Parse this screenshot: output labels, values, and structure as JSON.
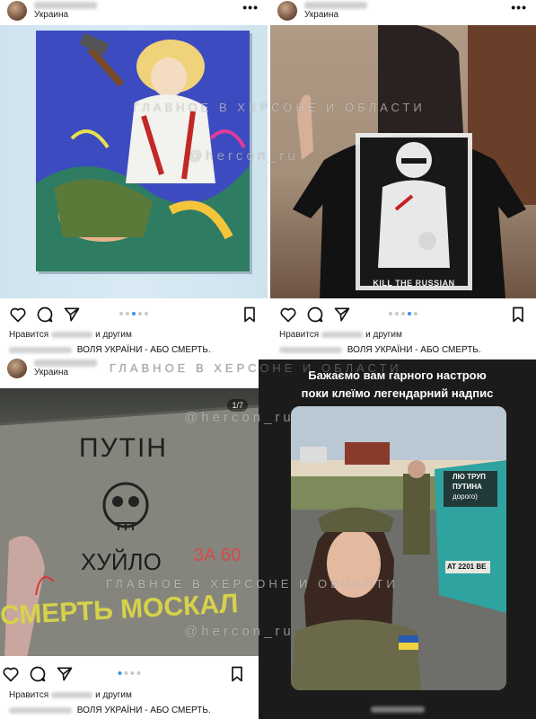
{
  "posts": [
    {
      "location": "Украина",
      "more": "•••",
      "likes_prefix": "Нравится",
      "likes_suffix": "и другим",
      "caption": "ВОЛЯ УКРАЇНИ - АБО СМЕРТЬ.",
      "carousel": {
        "count": 5,
        "active": 2
      }
    },
    {
      "location": "Украина",
      "more": "•••",
      "likes_prefix": "Нравится",
      "likes_suffix": "и другим",
      "caption": "ВОЛЯ УКРАЇНИ - АБО СМЕРТЬ.",
      "photo_text": "KILL THE RUSSIAN",
      "carousel": {
        "count": 5,
        "active": 3
      }
    },
    {
      "location": "Украина",
      "likes_prefix": "Нравится",
      "likes_suffix": "и другим",
      "caption": "ВОЛЯ УКРАЇНИ - АБО СМЕРТЬ.",
      "counter": "1/7",
      "wall_text": [
        "ПУТІН",
        "ХУЙЛО",
        "СМЕРТЬ МОСКАЛ",
        "ЗА 60"
      ],
      "carousel": {
        "count": 4,
        "active": 0
      }
    }
  ],
  "story": {
    "line1": "Бажаємо вам гарного настрою",
    "line2": "поки клеїмо легендарний надпис",
    "van_text": [
      "ЛЮ ТРУП",
      "ПУТИНА",
      "дорого)"
    ],
    "plate": "AT 2201 BE"
  },
  "watermark": {
    "title": "ГЛАВНОЕ В ХЕРСОНЕ И ОБЛАСТИ",
    "handle": "@hercon_ru"
  },
  "colors": {
    "carousel_active": "#3a8ef0",
    "story_bg": "#1b1b1b",
    "story_text": "#ffffff"
  }
}
